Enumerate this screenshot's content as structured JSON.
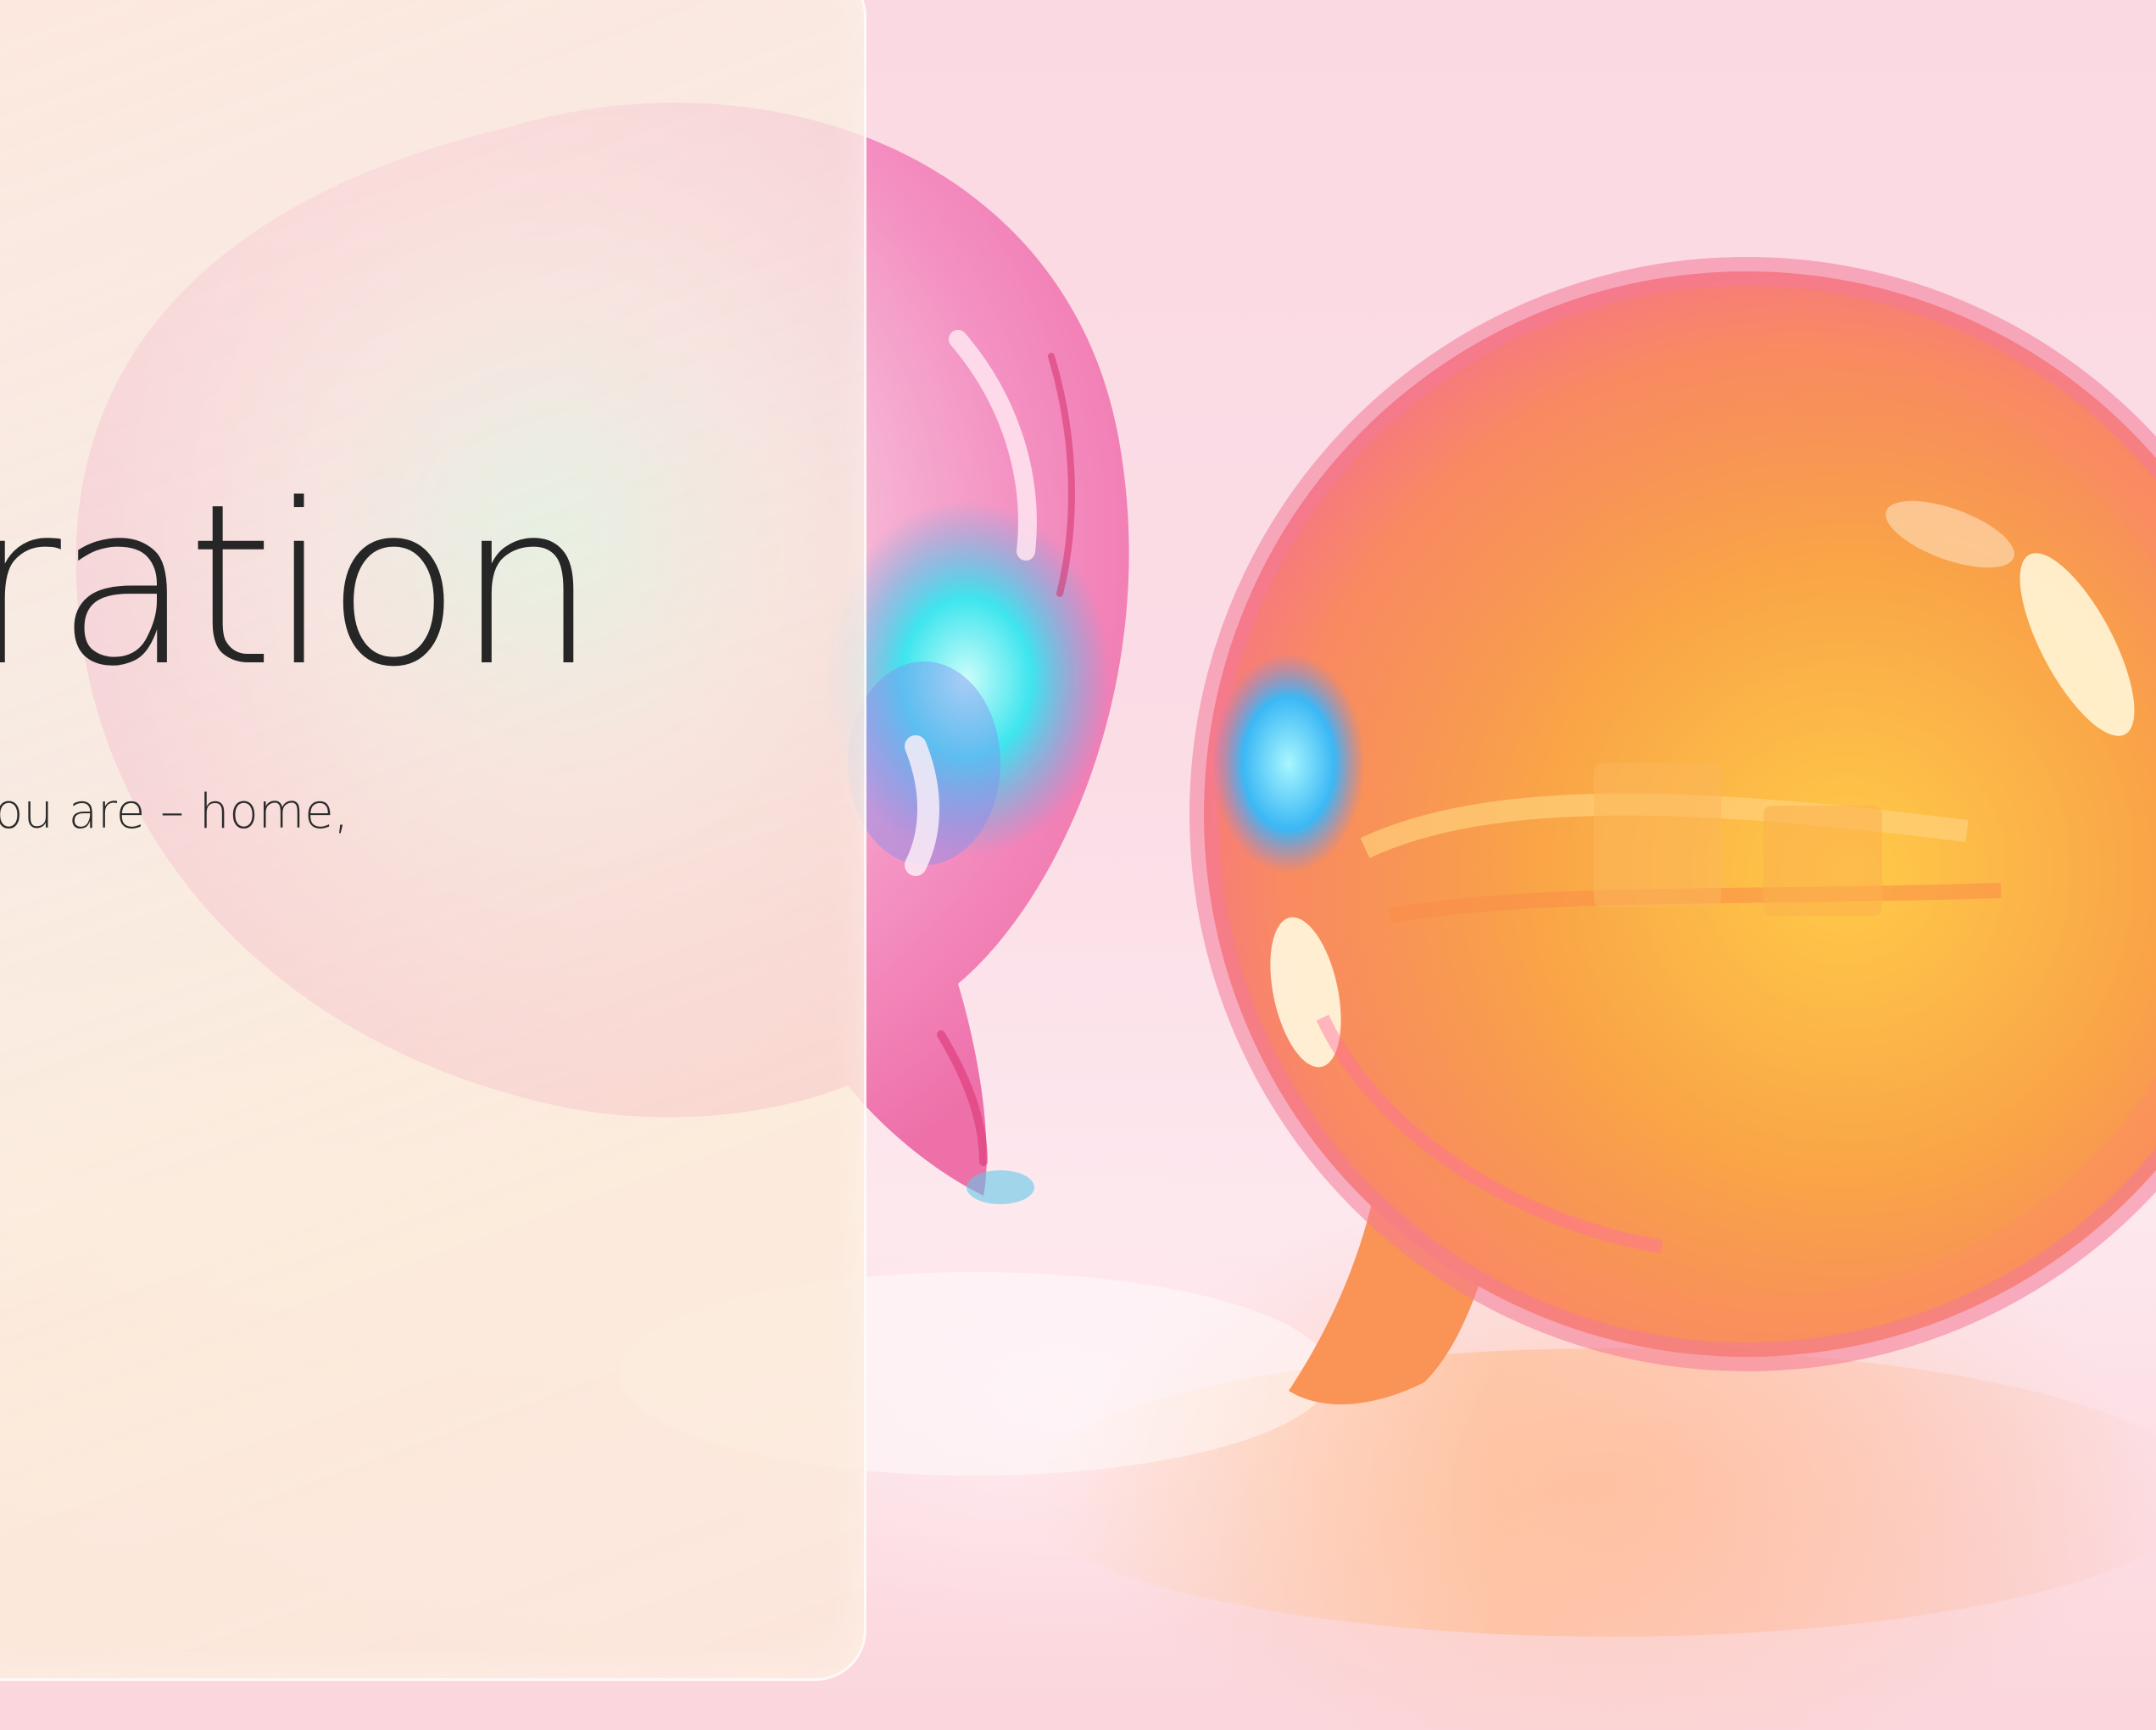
{
  "slide": {
    "title": "oration",
    "subtitle": "you are – home,"
  },
  "artwork": {
    "subject": "two glossy speech bubbles",
    "colors": {
      "pink_bubble": "#f27ab0",
      "orange_bubble": "#f7a046",
      "cyan_highlight": "#3ee6f0",
      "background": "#fbd9e3",
      "card_tint": "#fbecdc",
      "text": "#262626"
    }
  }
}
